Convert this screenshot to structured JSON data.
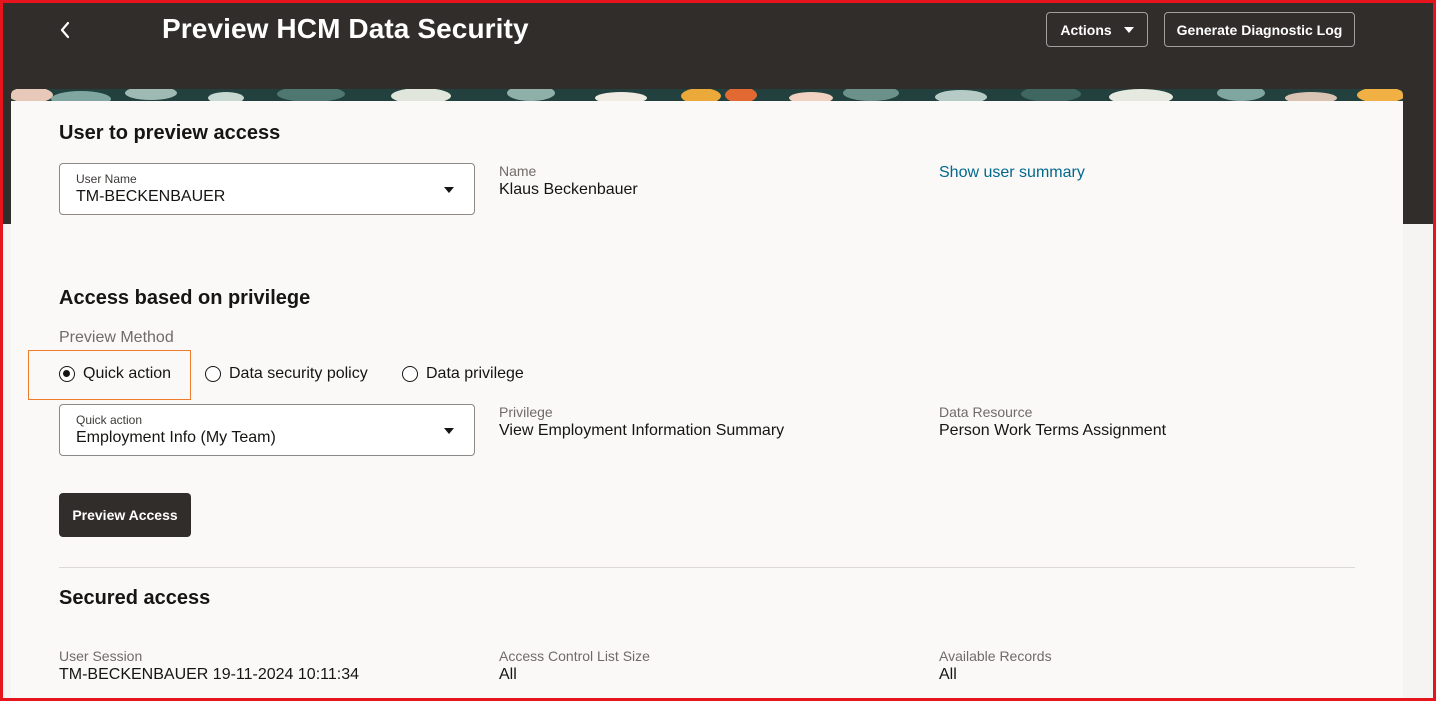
{
  "header": {
    "back_icon": "chevron-left-icon",
    "title": "Preview HCM Data Security",
    "actions_label": "Actions",
    "diagnostic_label": "Generate Diagnostic Log"
  },
  "user_section": {
    "title": "User to preview access",
    "user_select": {
      "label": "User Name",
      "value": "TM-BECKENBAUER"
    },
    "name_label": "Name",
    "name_value": "Klaus Beckenbauer",
    "summary_link": "Show user summary"
  },
  "privilege_section": {
    "title": "Access based on privilege",
    "method_label": "Preview Method",
    "methods": [
      {
        "label": "Quick action",
        "selected": true
      },
      {
        "label": "Data security policy",
        "selected": false
      },
      {
        "label": "Data privilege",
        "selected": false
      }
    ],
    "quick_action_select": {
      "label": "Quick action",
      "value": "Employment Info (My Team)"
    },
    "privilege_label": "Privilege",
    "privilege_value": "View Employment Information Summary",
    "resource_label": "Data Resource",
    "resource_value": "Person Work Terms Assignment",
    "preview_button": "Preview Access"
  },
  "secured_section": {
    "title": "Secured access",
    "session_label": "User Session",
    "session_value": "TM-BECKENBAUER 19-11-2024 10:11:34",
    "acl_label": "Access Control List Size",
    "acl_value": "All",
    "records_label": "Available Records",
    "records_value": "All"
  },
  "colors": {
    "header_bg": "#312d2a",
    "link": "#00688c",
    "highlight": "#f07b2a",
    "frame": "#e6141c"
  }
}
